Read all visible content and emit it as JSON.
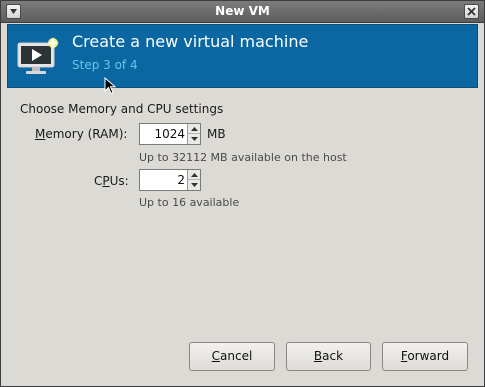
{
  "window": {
    "title": "New VM"
  },
  "banner": {
    "heading": "Create a new virtual machine",
    "step": "Step 3 of 4",
    "icon": "vm-monitor-icon",
    "colors": {
      "background": "#0b67a1",
      "step_text": "#6fc1ea"
    }
  },
  "section": {
    "title": "Choose Memory and CPU settings"
  },
  "memory": {
    "label_mnemonic": "M",
    "label_rest": "emory (RAM):",
    "value": "1024",
    "unit": "MB",
    "hint": "Up to 32112 MB available on the host"
  },
  "cpus": {
    "label_pre": "C",
    "label_mnemonic": "P",
    "label_post": "Us:",
    "value": "2",
    "hint": "Up to 16 available"
  },
  "buttons": {
    "cancel": {
      "mnemonic": "C",
      "rest": "ancel"
    },
    "back": {
      "mnemonic": "B",
      "rest": "ack"
    },
    "forward": {
      "mnemonic": "F",
      "rest": "orward"
    }
  }
}
